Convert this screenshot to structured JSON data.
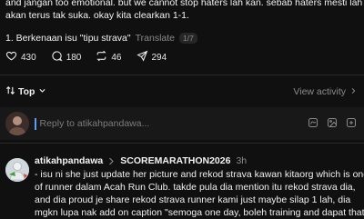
{
  "post": {
    "lines": [
      "and jangan too emotional. but we cannot stop haters lah kan. sebab haters mesti lah",
      "akan terus tak suka. okay kita clearkan 1-1."
    ],
    "list_item": "1. Berkenaan isu \"tipu strava\"",
    "translate_label": "Translate",
    "page_indicator": "1/7",
    "stats": {
      "likes": "430",
      "replies": "180",
      "reposts": "46",
      "shares": "294"
    }
  },
  "sort": {
    "label": "Top",
    "view_activity": "View activity"
  },
  "reply": {
    "placeholder": "Reply to atikahpandawa..."
  },
  "comment": {
    "author": "atikahpandawa",
    "tag": "SCOREMARATHON2026",
    "time": "3h",
    "lines": [
      "- isu ni she just update her picture and rekod strava kawan kitaorg which is one",
      "of runner dalam Acah Run Club. takde pula dia mention itu rekod strava dia,",
      "and dia proud je share rekod strava runner kami just maybe silap 1 lah, dia",
      "mgkn lupa nak add on caption \"semoga one day, boleh training and dapat that"
    ]
  },
  "icons": {
    "like": "heart-icon",
    "reply": "comment-icon",
    "repost": "repost-icon",
    "share": "send-icon",
    "sort": "sort-arrows-icon",
    "gif": "gif-icon",
    "image": "image-icon",
    "more": "more-icon"
  },
  "colors": {
    "background": "#101010",
    "reply_box": "#181818",
    "muted_text": "#8a8a8a",
    "caret": "#5b9cf5"
  }
}
